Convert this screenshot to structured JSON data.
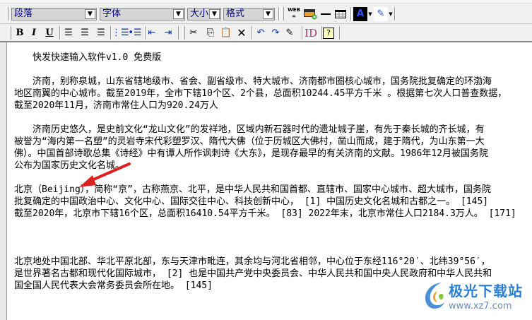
{
  "toolbar": {
    "paragraph_select": "段落",
    "font_select": "字体",
    "size_select": "大小",
    "format_select": "格式",
    "web_link_label": "WEB",
    "id_label": "ID",
    "row1_icons": [
      "web-link-icon",
      "insert-image-icon",
      "horizontal-rule-icon",
      "table-icon",
      "font-color-icon",
      "highlight-icon"
    ],
    "row2_icons": [
      "bold-icon",
      "italic-icon",
      "underline-icon",
      "align-left-icon",
      "align-center-icon",
      "align-right-icon",
      "ordered-list-icon",
      "unordered-list-icon",
      "outdent-icon",
      "indent-icon",
      "cut-icon",
      "copy-icon",
      "paste-icon",
      "delete-icon",
      "undo-icon",
      "redo-icon",
      "edit-icon",
      "id-icon",
      "help-icon"
    ],
    "font_color": "#000000",
    "accent_arrow": "#e02020"
  },
  "document": {
    "title": "快发快速输入软件v1.0 免费版",
    "para1": [
      "济南，别称泉城，山东省辖地级市、省会、副省级市、特大城市、济南都市圈核心城市，国务院批复确定的环渤海",
      "地区南翼的中心城市。截至2019年，全市下辖10个区、2个县，总面积10244.45平方千米 。根据第七次人口普查数据，",
      "截至2020年11月，济南市常住人口为920.24万人"
    ],
    "para2": [
      "济南历史悠久，是史前文化“龙山文化”的发祥地，区域内新石器时代的遗址城子崖，有先于秦长城的齐长城，有",
      "被誉为“海内第一名塑”的灵岩寺宋代彩塑罗汉、隋代大佛（位于历城区大佛村，凿山而成，建于隋代，为山东第一大",
      "佛）。中国首部诗歌总集《诗经》中有谭人所作讽刺诗《大东》，是现存最早的有关济南的文献。1986年12月被国务院",
      "公布为国家历史文化名城。"
    ],
    "para3": [
      "北京（Beijing），简称“京”，古称燕京、北平，是中华人民共和国首都、直辖市、国家中心城市、超大城市，国务院",
      "批复确定的中国政治中心、文化中心、国际交往中心、科技创新中心， [1]  中国历史文化名城和古都之一。 [145]",
      "截至2020年，北京市下辖16个区，总面积16410.54平方千米。 [83]  2022年末，北京市常住人口2184.3万人。 [171]"
    ],
    "para4": [
      "北京地处中国北部、华北平原北部，东与天津市毗连，其余均与河北省相邻，中心位于东经116°20′、北纬39°56′，",
      "是世界著名古都和现代化国际城市， [2]  也是中国共产党中央委员会、中华人民共和国中央人民政府和中华人民共和",
      "国全国人民代表大会常务委员会所在地。 [145]"
    ]
  },
  "watermark": {
    "name": "极光下载站",
    "url": "www.xz7.com"
  }
}
